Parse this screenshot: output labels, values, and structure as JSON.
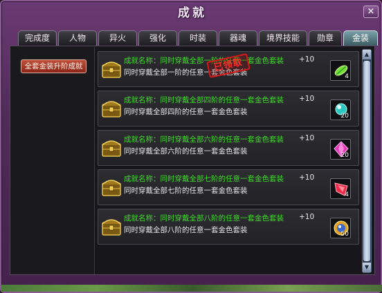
{
  "window": {
    "title": "成就",
    "close_label": "×"
  },
  "tabs": [
    {
      "label": "完成度",
      "active": false
    },
    {
      "label": "人物",
      "active": false
    },
    {
      "label": "异火",
      "active": false
    },
    {
      "label": "强化",
      "active": false
    },
    {
      "label": "时装",
      "active": false
    },
    {
      "label": "器魂",
      "active": false
    },
    {
      "label": "境界技能",
      "active": false
    },
    {
      "label": "勋章",
      "active": false
    },
    {
      "label": "金装",
      "active": true
    }
  ],
  "sidebar": {
    "category_button": "全套金装升阶成就"
  },
  "achievements": [
    {
      "name": "成就名称：同时穿戴全部一阶的任意一套金色套装",
      "reward_value": "+10",
      "description": "同时穿戴全部一阶的任意一套金色套装",
      "item_icon": "green-leaf-gem-icon",
      "item_count": "4",
      "claimed": true,
      "stamp_text": "已领取"
    },
    {
      "name": "成就名称：同时穿戴全部四阶的任意一套金色套装",
      "reward_value": "+10",
      "description": "同时穿戴全部四阶的任意一套金色套装",
      "item_icon": "cyan-orb-gem-icon",
      "item_count": "20",
      "claimed": false
    },
    {
      "name": "成就名称：同时穿戴全部六阶的任意一套金色套装",
      "reward_value": "+10",
      "description": "同时穿戴全部六阶的任意一套金色套装",
      "item_icon": "pink-crystal-gem-icon",
      "item_count": "20",
      "claimed": false
    },
    {
      "name": "成就名称：同时穿戴全部七阶的任意一套金色套装",
      "reward_value": "+10",
      "description": "同时穿戴全部七阶的任意一套金色套装",
      "item_icon": "red-shard-gem-icon",
      "item_count": "4",
      "claimed": false
    },
    {
      "name": "成就名称：同时穿戴全部八阶的任意一套金色套装",
      "reward_value": "+10",
      "description": "同时穿戴全部八阶的任意一套金色套装",
      "item_icon": "golden-flame-orb-icon",
      "item_count": "50",
      "claimed": false
    }
  ],
  "colors": {
    "achievement_name": "#3fdc2a",
    "active_tab": "#5a8088",
    "stamp": "#d81818"
  }
}
